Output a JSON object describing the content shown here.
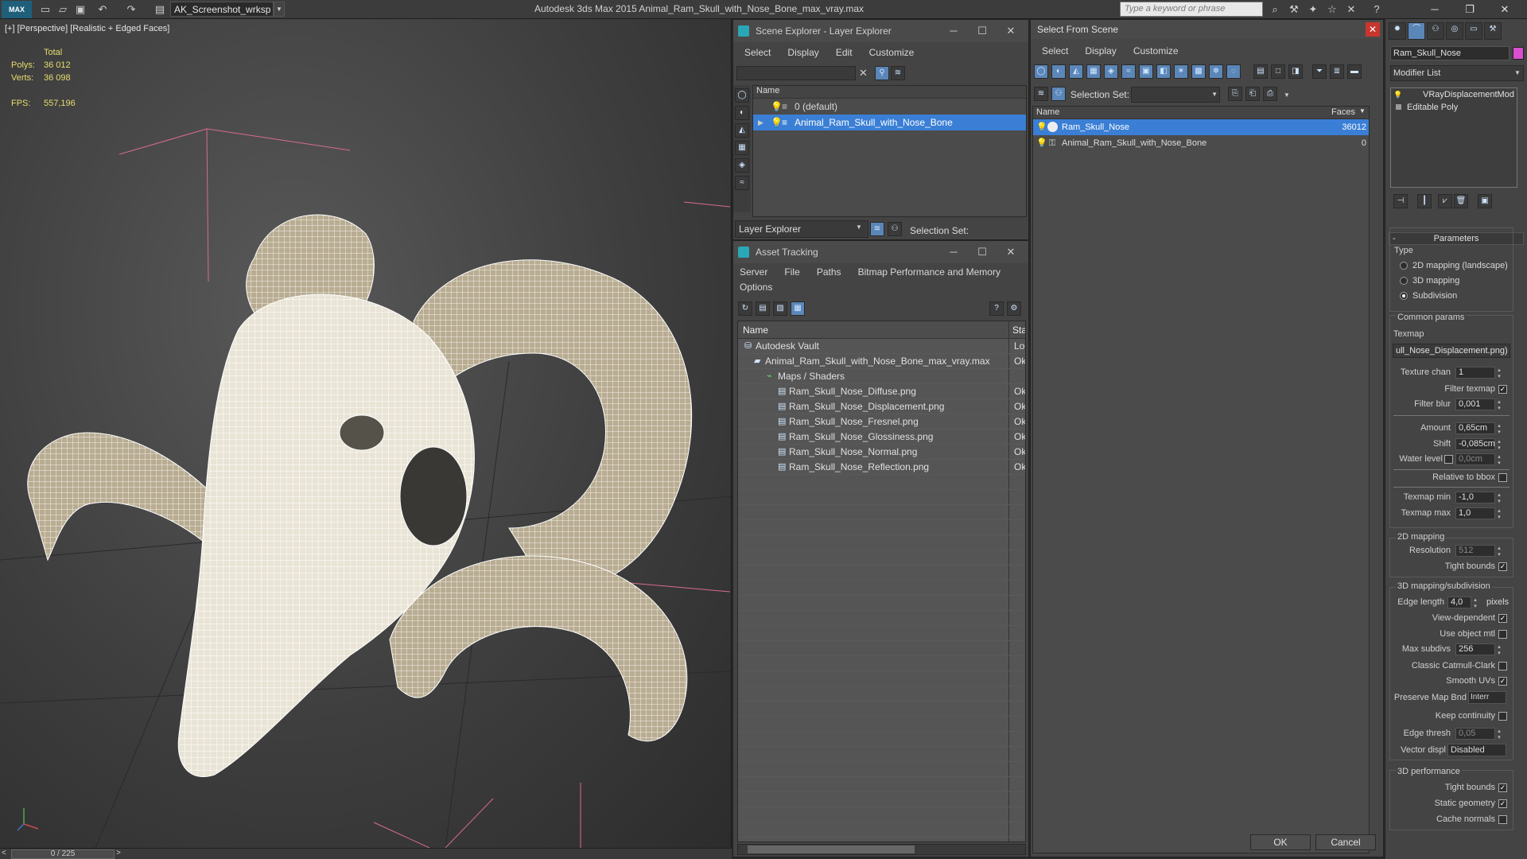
{
  "app": {
    "logo": "MAX",
    "workspace": "AK_Screenshot_wrksp",
    "title": "Autodesk 3ds Max  2015     Animal_Ram_Skull_with_Nose_Bone_max_vray.max",
    "search_placeholder": "Type a keyword or phrase"
  },
  "viewport": {
    "label": "[+] [Perspective] [Realistic + Edged Faces]",
    "stats": {
      "total_label": "Total",
      "polys_label": "Polys:",
      "polys_value": "36 012",
      "verts_label": "Verts:",
      "verts_value": "36 098",
      "fps_label": "FPS:",
      "fps_value": "557,196"
    }
  },
  "timeline": {
    "frame": "0 / 225",
    "prev": "<",
    "next": ">"
  },
  "scene_explorer": {
    "title": "Scene Explorer - Layer Explorer",
    "menu": [
      "Select",
      "Display",
      "Edit",
      "Customize"
    ],
    "column": "Name",
    "layers": [
      {
        "name": "0 (default)",
        "selected": false
      },
      {
        "name": "Animal_Ram_Skull_with_Nose_Bone",
        "selected": true
      }
    ],
    "footer_dropdown": "Layer Explorer",
    "selection_set_label": "Selection Set:"
  },
  "asset_tracking": {
    "title": "Asset Tracking",
    "menu_row1": [
      "Server",
      "File",
      "Paths",
      "Bitmap Performance and Memory"
    ],
    "menu_row2": [
      "Options"
    ],
    "columns": [
      "Name",
      "Stat"
    ],
    "rows": [
      {
        "name": "Autodesk Vault",
        "status": "Log",
        "indent": 1
      },
      {
        "name": "Animal_Ram_Skull_with_Nose_Bone_max_vray.max",
        "status": "Ok",
        "indent": 2
      },
      {
        "name": "Maps / Shaders",
        "status": "",
        "indent": 3
      },
      {
        "name": "Ram_Skull_Nose_Diffuse.png",
        "status": "Ok",
        "indent": 4
      },
      {
        "name": "Ram_Skull_Nose_Displacement.png",
        "status": "Ok",
        "indent": 4
      },
      {
        "name": "Ram_Skull_Nose_Fresnel.png",
        "status": "Ok",
        "indent": 4
      },
      {
        "name": "Ram_Skull_Nose_Glossiness.png",
        "status": "Ok",
        "indent": 4
      },
      {
        "name": "Ram_Skull_Nose_Normal.png",
        "status": "Ok",
        "indent": 4
      },
      {
        "name": "Ram_Skull_Nose_Reflection.png",
        "status": "Ok",
        "indent": 4
      }
    ]
  },
  "select_from_scene": {
    "title": "Select From Scene",
    "menu": [
      "Select",
      "Display",
      "Customize"
    ],
    "selection_set_label": "Selection Set:",
    "columns": [
      "Name",
      "Faces"
    ],
    "rows": [
      {
        "name": "Ram_Skull_Nose",
        "faces": "36012",
        "selected": true
      },
      {
        "name": "Animal_Ram_Skull_with_Nose_Bone",
        "faces": "0",
        "selected": false
      }
    ],
    "ok": "OK",
    "cancel": "Cancel"
  },
  "modify_panel": {
    "object_name": "Ram_Skull_Nose",
    "object_color": "#d84fd0",
    "modifier_list": "Modifier List",
    "stack": [
      "VRayDisplacementMod",
      "Editable Poly"
    ],
    "parameters_title": "Parameters",
    "type_label": "Type",
    "type_options": [
      {
        "label": "2D mapping (landscape)",
        "on": false
      },
      {
        "label": "3D mapping",
        "on": false
      },
      {
        "label": "Subdivision",
        "on": true
      }
    ],
    "common_params": "Common params",
    "texmap_label": "Texmap",
    "texmap_value": "ull_Nose_Displacement.png)",
    "texture_chan_label": "Texture chan",
    "texture_chan": "1",
    "filter_texmap_label": "Filter texmap",
    "filter_blur_label": "Filter blur",
    "filter_blur": "0,001",
    "amount_label": "Amount",
    "amount": "0,65cm",
    "shift_label": "Shift",
    "shift": "-0,085cm",
    "water_level_label": "Water level",
    "water_level": "0,0cm",
    "relative_bbox_label": "Relative to bbox",
    "texmap_min_label": "Texmap min",
    "texmap_min": "-1,0",
    "texmap_max_label": "Texmap max",
    "texmap_max": "1,0",
    "mapping2d_title": "2D mapping",
    "resolution_label": "Resolution",
    "resolution": "512",
    "tight_bounds_label": "Tight bounds",
    "mapping3d_title": "3D mapping/subdivision",
    "edge_length_label": "Edge length",
    "edge_length": "4,0",
    "pixels_label": "pixels",
    "view_dependent_label": "View-dependent",
    "use_object_mtl_label": "Use object mtl",
    "max_subdivs_label": "Max subdivs",
    "max_subdivs": "256",
    "classic_cc_label": "Classic Catmull-Clark",
    "smooth_uvs_label": "Smooth UVs",
    "preserve_map_label": "Preserve Map Bnd",
    "preserve_map_value": "Interr",
    "keep_continuity_label": "Keep continuity",
    "edge_thresh_label": "Edge thresh",
    "edge_thresh": "0,05",
    "vector_displ_label": "Vector displ",
    "vector_displ_value": "Disabled",
    "performance_title": "3D performance",
    "tight_bounds2_label": "Tight bounds",
    "static_geometry_label": "Static geometry",
    "cache_normals_label": "Cache normals"
  }
}
